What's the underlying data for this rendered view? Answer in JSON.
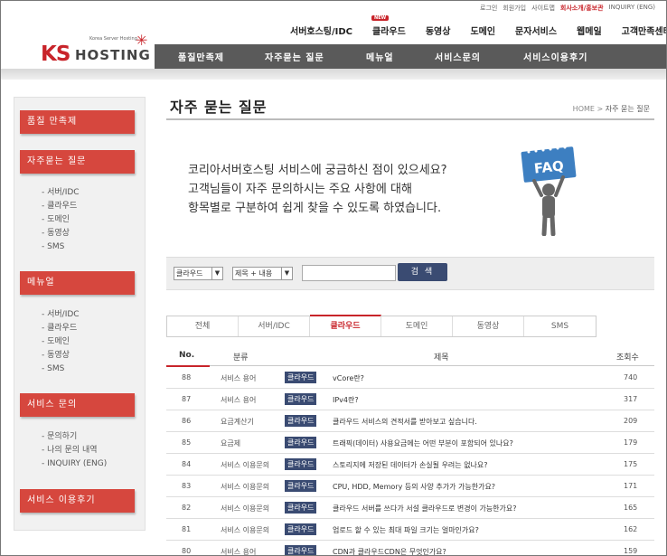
{
  "util_links": [
    "로그인",
    "회원가입",
    "사이트맵",
    "회사소개/홍보관",
    "INQUIRY (ENG)"
  ],
  "logo": {
    "ks": "KS",
    "hosting": "HOSTING",
    "tagline": "Korea Server Hosting"
  },
  "top_nav": [
    "서버호스팅/IDC",
    "클라우드",
    "동영상",
    "도메인",
    "문자서비스",
    "웹메일",
    "고객만족센터"
  ],
  "new_badge": "NEW",
  "main_nav": [
    "품질만족제",
    "자주묻는 질문",
    "메뉴얼",
    "서비스문의",
    "서비스이용후기"
  ],
  "sidebar": {
    "sections": [
      {
        "title": "품질 만족제",
        "items": []
      },
      {
        "title": "자주묻는 질문",
        "items": [
          "- 서버/IDC",
          "- 클라우드",
          "- 도메인",
          "- 동영상",
          "- SMS"
        ]
      },
      {
        "title": "메뉴얼",
        "items": [
          "- 서버/IDC",
          "- 클라우드",
          "- 도메인",
          "- 동영상",
          "- SMS"
        ]
      },
      {
        "title": "서비스 문의",
        "items": [
          "- 문의하기",
          "- 나의 문의 내역",
          "- INQUIRY (ENG)"
        ]
      },
      {
        "title": "서비스 이용후기",
        "items": []
      }
    ]
  },
  "page_title": "자주 묻는 질문",
  "breadcrumb": {
    "home": "HOME",
    "sep": ">",
    "current": "자주 묻는 질문"
  },
  "intro": [
    "코리아서버호스팅 서비스에 궁금하신 점이 있으세요?",
    "고객님들이 자주 문의하시는 주요 사항에 대해",
    "항목별로 구분하여 쉽게 찾을 수 있도록 하였습니다."
  ],
  "faq_sign": "FAQ",
  "search": {
    "category_select": "클라우드",
    "field_select": "제목 + 내용",
    "query": "",
    "button": "검 색"
  },
  "tabs": [
    "전체",
    "서버/IDC",
    "클라우드",
    "도메인",
    "동영상",
    "SMS"
  ],
  "active_tab": "클라우드",
  "table": {
    "headers": {
      "no": "No.",
      "category": "분류",
      "title": "제목",
      "views": "조회수"
    },
    "rows": [
      {
        "no": "88",
        "category": "서비스 용어",
        "badge": "클라우드",
        "title": "vCore란?",
        "views": "740"
      },
      {
        "no": "87",
        "category": "서비스 용어",
        "badge": "클라우드",
        "title": "IPv4란?",
        "views": "317"
      },
      {
        "no": "86",
        "category": "요금계산기",
        "badge": "클라우드",
        "title": "클라우드 서비스의 견적서를 받아보고 싶습니다.",
        "views": "209"
      },
      {
        "no": "85",
        "category": "요금제",
        "badge": "클라우드",
        "title": "트래픽(데이터) 사용요금에는 어떤 부분이 포함되어 있나요?",
        "views": "179"
      },
      {
        "no": "84",
        "category": "서비스 이용문의",
        "badge": "클라우드",
        "title": "스토리지에 저장된 데이터가 손실될 우려는 없나요?",
        "views": "175"
      },
      {
        "no": "83",
        "category": "서비스 이용문의",
        "badge": "클라우드",
        "title": "CPU, HDD, Memory 등의 사양 추가가 가능한가요?",
        "views": "171"
      },
      {
        "no": "82",
        "category": "서비스 이용문의",
        "badge": "클라우드",
        "title": "클라우드 서버를 쓰다가 서설 클라우드로 변경이 가능한가요?",
        "views": "165"
      },
      {
        "no": "81",
        "category": "서비스 이용문의",
        "badge": "클라우드",
        "title": "업로드 할 수 있는 최대 파일 크기는 얼마인가요?",
        "views": "162"
      },
      {
        "no": "80",
        "category": "서비스 용어",
        "badge": "클라우드",
        "title": "CDN과 클라우드CDN은 무엇인가요?",
        "views": "159"
      }
    ]
  },
  "colors": {
    "accent": "#c8242a",
    "nav_bg": "#5a5a5a",
    "badge_bg": "#3a4b72",
    "sidebar_head": "#d6473e"
  }
}
